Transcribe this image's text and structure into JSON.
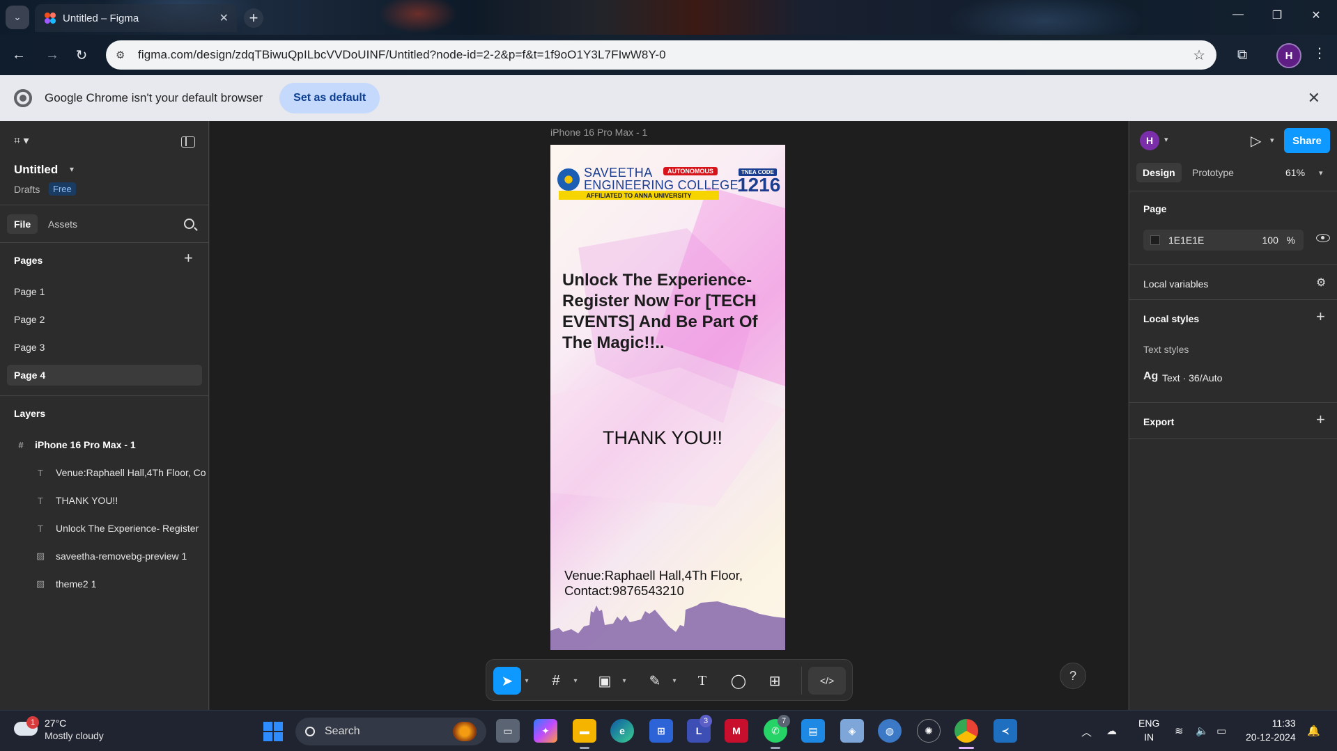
{
  "browser": {
    "tab_title": "Untitled – Figma",
    "url": "figma.com/design/zdqTBiwuQpILbcVVDoUINF/Untitled?node-id=2-2&p=f&t=1f9oO1Y3L7FIwW8Y-0",
    "profile_initial": "H",
    "infobar_message": "Google Chrome isn't your default browser",
    "infobar_button": "Set as default"
  },
  "figma": {
    "file_name": "Untitled",
    "location": "Drafts",
    "plan_badge": "Free",
    "tabs": {
      "file": "File",
      "assets": "Assets"
    },
    "pages_heading": "Pages",
    "pages": [
      {
        "label": "Page 1",
        "active": false
      },
      {
        "label": "Page 2",
        "active": false
      },
      {
        "label": "Page 3",
        "active": false
      },
      {
        "label": "Page 4",
        "active": true
      }
    ],
    "layers_heading": "Layers",
    "layers": [
      {
        "label": "iPhone 16 Pro Max - 1",
        "icon": "frame-icon",
        "level": 0
      },
      {
        "label": "Venue:Raphaell Hall,4Th Floor, Co",
        "icon": "text-layer-icon",
        "level": 1
      },
      {
        "label": "THANK YOU!!",
        "icon": "text-layer-icon",
        "level": 1
      },
      {
        "label": "Unlock The Experience- Register",
        "icon": "text-layer-icon",
        "level": 1
      },
      {
        "label": "saveetha-removebg-preview 1",
        "icon": "image-layer-icon",
        "level": 1
      },
      {
        "label": "theme2 1",
        "icon": "image-layer-icon",
        "level": 1
      }
    ],
    "frame_label": "iPhone 16 Pro Max - 1",
    "poster": {
      "logo_line1": "SAVEETHA",
      "logo_line2": "ENGINEERING COLLEGE",
      "logo_autonomous": "AUTONOMOUS",
      "logo_affiliated": "AFFILIATED TO ANNA UNIVERSITY",
      "tnea_label": "TNEA CODE",
      "tnea_code": "1216",
      "headline": "Unlock The Experience- Register Now For [TECH EVENTS] And Be Part Of The Magic!!..",
      "thanks": "THANK YOU!!",
      "venue_line1": "Venue:Raphaell Hall,4Th Floor,",
      "venue_line2": "Contact:9876543210"
    },
    "right_panel": {
      "user_initial": "H",
      "share_label": "Share",
      "tab_design": "Design",
      "tab_prototype": "Prototype",
      "zoom": "61%",
      "page_heading": "Page",
      "page_color": "1E1E1E",
      "page_opacity": "100",
      "page_opacity_unit": "%",
      "local_variables": "Local variables",
      "local_styles": "Local styles",
      "text_styles_heading": "Text styles",
      "text_style_sample": "Ag",
      "text_style_name": "Text · 36/Auto",
      "export": "Export"
    },
    "help": "?"
  },
  "taskbar": {
    "weather_temp": "27°C",
    "weather_desc": "Mostly cloudy",
    "weather_badge": "1",
    "search_placeholder": "Search",
    "teams_badge": "3",
    "whatsapp_badge": "7",
    "lang_line1": "ENG",
    "lang_line2": "IN",
    "time": "11:33",
    "date": "20-12-2024"
  },
  "colors": {
    "figma_blue": "#0d99ff",
    "panel_bg": "#2c2c2c",
    "canvas_bg": "#1e1e1e"
  }
}
